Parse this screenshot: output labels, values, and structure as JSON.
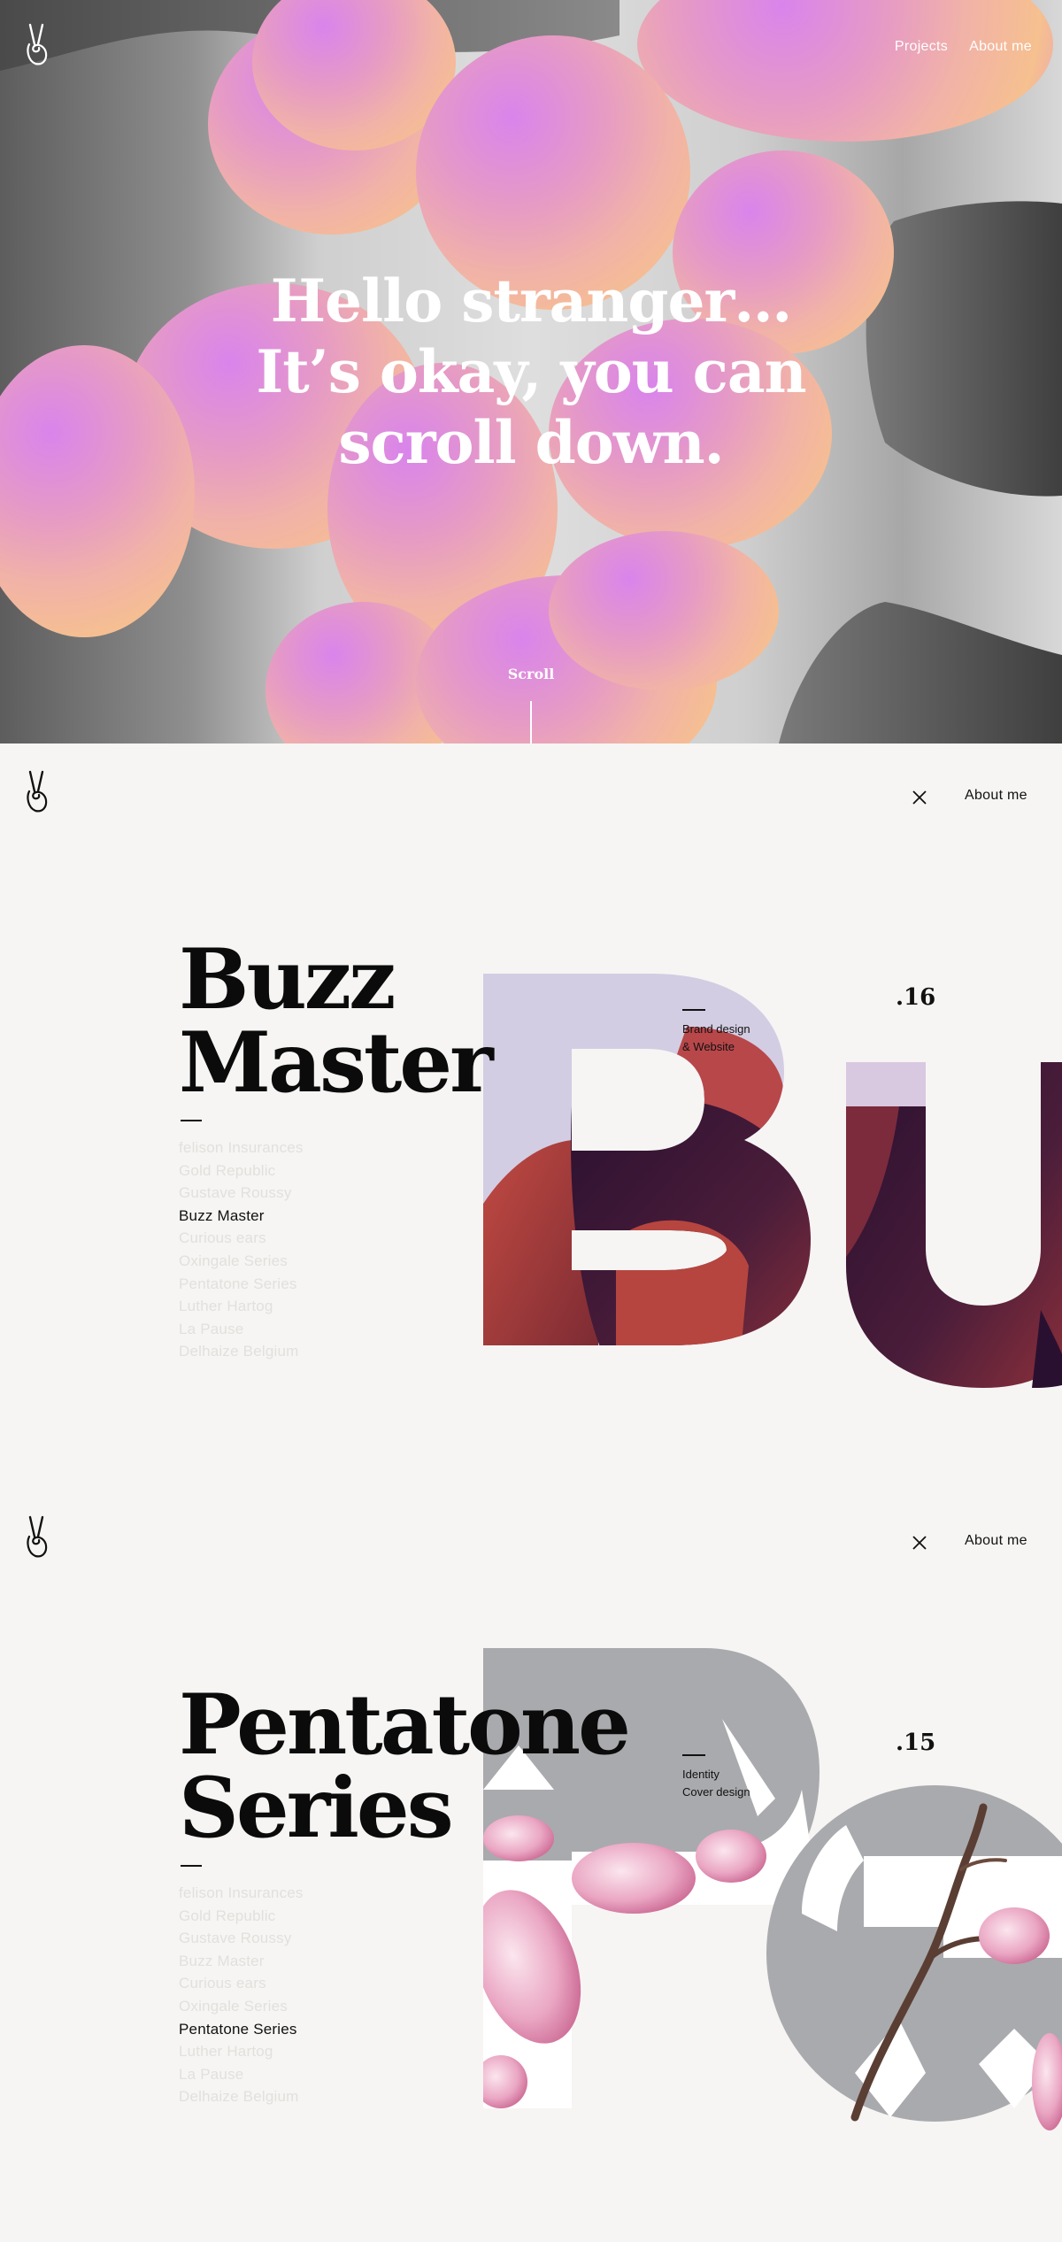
{
  "hero": {
    "nav": [
      {
        "label": "Projects"
      },
      {
        "label": "About me"
      }
    ],
    "title_lines": [
      "Hello stranger…",
      "It’s okay, you can",
      "scroll down."
    ],
    "scroll_label": "Scroll"
  },
  "projects": [
    {
      "title_lines": [
        "Buzz",
        "Master"
      ],
      "number": ".16",
      "tags": [
        "Brand design",
        "& Website"
      ],
      "about_label": "About me",
      "list": [
        "felison Insurances",
        "Gold Republic",
        "Gustave Roussy",
        "Buzz Master",
        "Curious ears",
        "Oxingale Series",
        "Pentatone Series",
        "Luther Hartog",
        "La Pause",
        "Delhaize Belgium"
      ],
      "active_index": 3,
      "colors": {
        "light": "#cdc8df",
        "dark": "#2f1433",
        "red": "#b3443d"
      }
    },
    {
      "title_lines": [
        "Pentatone",
        "Series"
      ],
      "number": ".15",
      "tags": [
        "Identity",
        "Cover design"
      ],
      "about_label": "About me",
      "list": [
        "felison Insurances",
        "Gold Republic",
        "Gustave Roussy",
        "Buzz Master",
        "Curious ears",
        "Oxingale Series",
        "Pentatone Series",
        "Luther Hartog",
        "La Pause",
        "Delhaize Belgium"
      ],
      "active_index": 6,
      "colors": {
        "grey": "#a7a8ab",
        "pink": "#e9a7c3",
        "branch": "#5a3e33"
      }
    }
  ],
  "icons": {
    "logo": "peace-hand-icon",
    "close": "close-icon"
  }
}
